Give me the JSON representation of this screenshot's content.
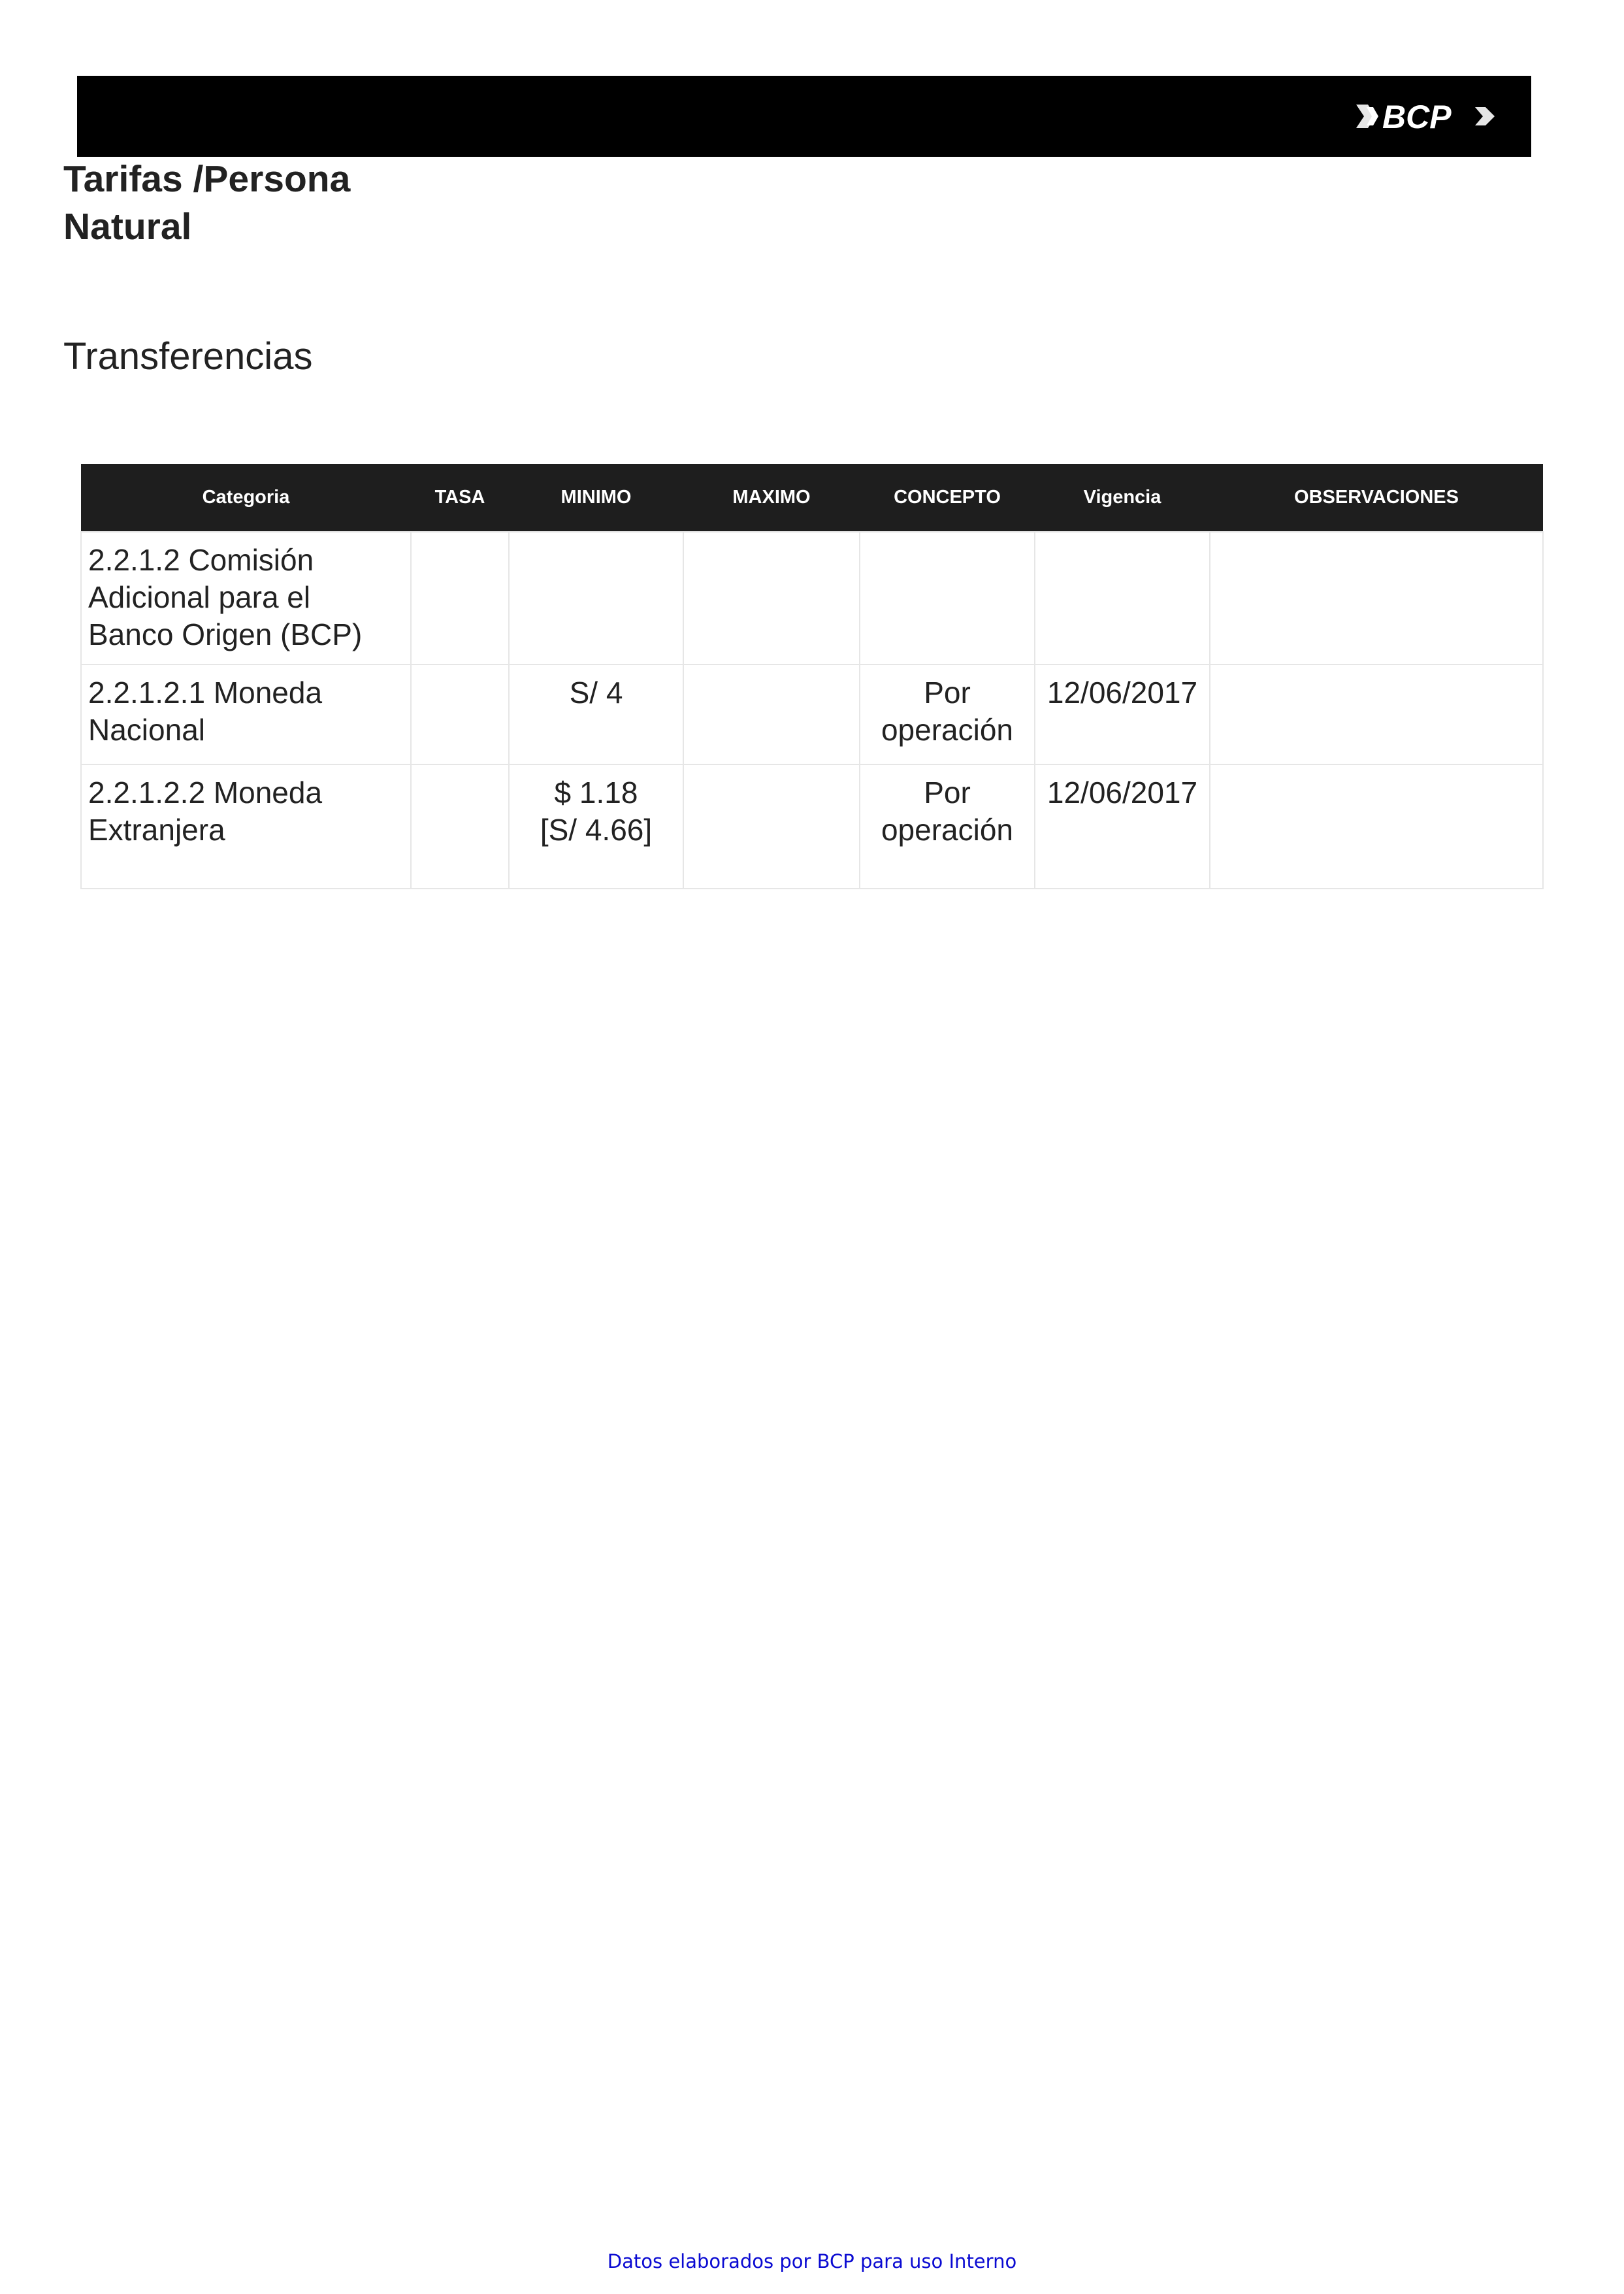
{
  "header": {
    "logo_text": "BCP",
    "logo_icon": "bcp-logo"
  },
  "document": {
    "title": "Tarifas /Persona Natural",
    "section": "Transferencias"
  },
  "table": {
    "columns": [
      "Categoria",
      "TASA",
      "MINIMO",
      "MAXIMO",
      "CONCEPTO",
      "Vigencia",
      "OBSERVACIONES"
    ],
    "rows": [
      {
        "categoria": "2.2.1.2 Comisión Adicional para el Banco Origen (BCP)",
        "tasa": "",
        "minimo": "",
        "minimo_alt": "",
        "maximo": "",
        "concepto": "",
        "vigencia": "",
        "observaciones": ""
      },
      {
        "categoria": "2.2.1.2.1 Moneda Nacional",
        "tasa": "",
        "minimo": "S/ 4",
        "minimo_alt": "",
        "maximo": "",
        "concepto": "Por operación",
        "vigencia": "12/06/2017",
        "observaciones": ""
      },
      {
        "categoria": "2.2.1.2.2 Moneda Extranjera",
        "tasa": "",
        "minimo": "$ 1.18",
        "minimo_alt": "[S/ 4.66]",
        "maximo": "",
        "concepto": "Por operación",
        "vigencia": "12/06/2017",
        "observaciones": ""
      }
    ]
  },
  "footer": {
    "text": "Datos elaborados por BCP para uso Interno"
  },
  "colors": {
    "header_bar": "#000000",
    "table_header": "#1e1e1e",
    "footer_text": "#0a0ad2"
  }
}
